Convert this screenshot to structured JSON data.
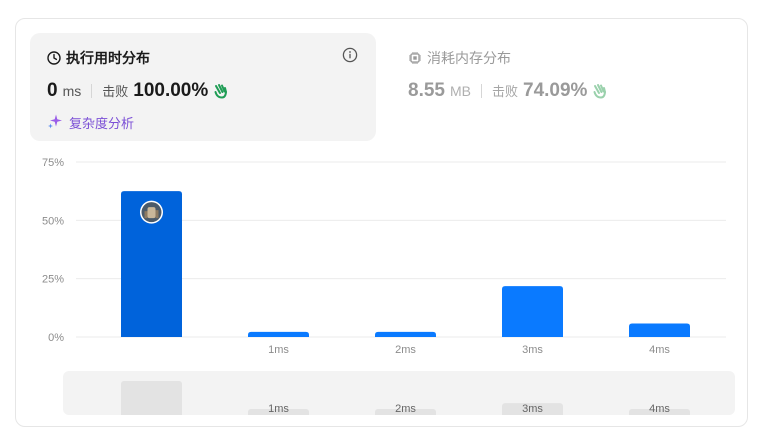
{
  "runtime_card": {
    "title": "执行用时分布",
    "value": "0",
    "unit": "ms",
    "beats_label": "击败",
    "beats_value": "100.00%",
    "complexity_link": "复杂度分析"
  },
  "memory_card": {
    "title": "消耗内存分布",
    "value": "8.55",
    "unit": "MB",
    "beats_label": "击败",
    "beats_value": "74.09%"
  },
  "colors": {
    "bar": "#0a7aff",
    "bar_dark": "#0063db",
    "grid": "#ebebeb",
    "tick": "#8c8c8c",
    "scrub_bar": "#e3e3e3",
    "hand": "#1f9d55",
    "hand_faded": "#9ad1ac",
    "purple": "#7b4fd6"
  },
  "icons": {
    "runtime": "clock-icon",
    "memory": "chip-icon",
    "info": "info-icon",
    "beats": "waving-hand-icon",
    "complexity": "sparkle-icon",
    "marker": "user-avatar"
  },
  "chart_data": {
    "type": "bar",
    "categories": [
      "",
      "1ms",
      "2ms",
      "3ms",
      "4ms"
    ],
    "values": [
      62.5,
      2.2,
      2.2,
      21.8,
      5.8
    ],
    "highlight_index": 0,
    "xlabel": "",
    "ylabel": "",
    "ylim": [
      0,
      75
    ],
    "yticks": [
      0,
      25,
      50,
      75
    ],
    "ytick_labels": [
      "0%",
      "25%",
      "50%",
      "75%"
    ],
    "grid": true,
    "legend": "none"
  },
  "scrubber": {
    "labels": [
      "",
      "1ms",
      "2ms",
      "3ms",
      "4ms"
    ]
  }
}
